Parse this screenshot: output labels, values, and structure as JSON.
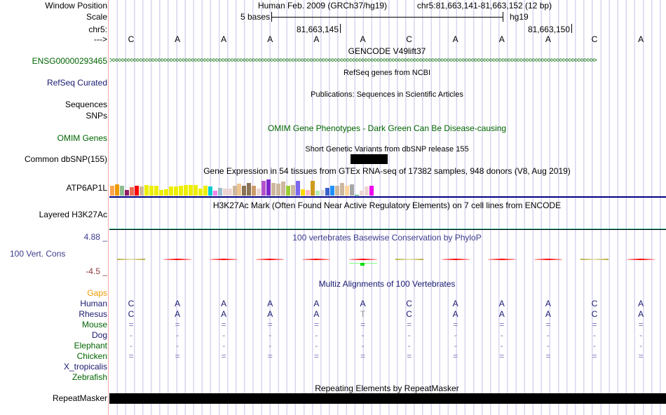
{
  "header": {
    "window_position_label": "Window Position",
    "assembly": "Human Feb. 2009 (GRCh37/hg19)",
    "position": "chr5:81,663,141-81,663,152 (12 bp)",
    "scale_label": "Scale",
    "scale_text": "5 bases",
    "scale_db": "hg19",
    "chrom_label": "chr5:",
    "tick1": "81,663,145",
    "tick2": "81,663,150",
    "strand_label": "--->"
  },
  "bases": [
    "C",
    "A",
    "A",
    "A",
    "A",
    "A",
    "C",
    "A",
    "A",
    "A",
    "C",
    "A"
  ],
  "tracks": {
    "gencode": {
      "title": "GENCODE V49lift37",
      "label": "ENSG00000293465",
      "color": "#006400"
    },
    "refseq": {
      "title": "RefSeq genes from NCBI",
      "label": "RefSeq Curated"
    },
    "pubs": {
      "title": "Publications: Sequences in Scientific Articles",
      "label1": "Sequences",
      "label2": "SNPs"
    },
    "omim": {
      "title": "OMIM Gene Phenotypes - Dark Green Can Be Disease-causing",
      "label": "OMIM Genes"
    },
    "dbsnp": {
      "title": "Short Genetic Variants from dbSNP release 155",
      "label": "Common dbSNP(155)"
    },
    "gtex": {
      "title": "Gene Expression in 54 tissues from GTEx RNA-seq of 17382 samples, 948 donors (V8, Aug 2019)",
      "label": "ATP6AP1L",
      "values": [
        14,
        12,
        14,
        20,
        16,
        14,
        15,
        13,
        14,
        14,
        20,
        19,
        15,
        15,
        14,
        13,
        13,
        13,
        18,
        14,
        15,
        21,
        17,
        18,
        18,
        14,
        11,
        14,
        10,
        14,
        18,
        7,
        5,
        10,
        11,
        8,
        14,
        13,
        7,
        19,
        20,
        7,
        21,
        20,
        17,
        14,
        14,
        10,
        14,
        12,
        27,
        21,
        15,
        14
      ],
      "colors": [
        "#ffa54f",
        "#ee9a00",
        "#8fbc8f",
        "#8b1c62",
        "#ee6a50",
        "#ff0000",
        "#cdb79e",
        "#eeee00",
        "#eeee00",
        "#eeee00",
        "#eeee00",
        "#eeee00",
        "#eeee00",
        "#eeee00",
        "#eeee00",
        "#eeee00",
        "#eeee00",
        "#eeee00",
        "#eeee00",
        "#eeee00",
        "#00cdcd",
        "#ee82ee",
        "#9ac0cd",
        "#eed5d2",
        "#eed5d2",
        "#cdb79e",
        "#eec591",
        "#8b7355",
        "#8b7355",
        "#cd9b69",
        "#eed5d2",
        "#b452cd",
        "#7d26cd",
        "#cdb79e",
        "#cdb79e",
        "#cdb79e",
        "#9acd32",
        "#cdb79e",
        "#7b68ee",
        "#ffd700",
        "#ffb6c1",
        "#cd9b1d",
        "#b4eeb4",
        "#d9d9d9",
        "#3a5fcd",
        "#1e90ff",
        "#cdb79e",
        "#cdb79e",
        "#ffd39b",
        "#a6a6a6",
        "#008b45",
        "#eed5d2",
        "#eed5d2",
        "#ee00ee"
      ]
    },
    "h3k27ac": {
      "title": "H3K27Ac Mark (Often Found Near Active Regulatory Elements) on 7 cell lines from ENCODE",
      "label": "Layered H3K27Ac"
    },
    "phylop": {
      "title": "100 vertebrates Basewise Conservation by PhyloP",
      "label": "100 Vert. Cons",
      "max": "4.88 _",
      "min": "-4.5 _",
      "scores": [
        "olive",
        "red",
        "red",
        "red",
        "red",
        "red+green",
        "olive",
        "red",
        "red",
        "red",
        "olive",
        "red"
      ]
    },
    "multiz": {
      "title": "Multiz Alignments of 100 Vertebrates",
      "gaps_label": "Gaps",
      "species": [
        {
          "name": "Human",
          "color": "#191970",
          "row": [
            "C",
            "A",
            "A",
            "A",
            "A",
            "A",
            "C",
            "A",
            "A",
            "A",
            "C",
            "A"
          ]
        },
        {
          "name": "Rhesus",
          "color": "#191970",
          "row": [
            "C",
            "A",
            "A",
            "A",
            "A",
            "T",
            "C",
            "A",
            "A",
            "A",
            "C",
            "A"
          ]
        },
        {
          "name": "Mouse",
          "color": "#006400",
          "row": [
            "=",
            "=",
            "=",
            "=",
            "=",
            "=",
            "=",
            "=",
            "=",
            "=",
            "=",
            "="
          ]
        },
        {
          "name": "Dog",
          "color": "#191970",
          "row": [
            "-",
            "-",
            "-",
            "-",
            "-",
            "-",
            "-",
            "-",
            "-",
            "-",
            "-",
            "-"
          ]
        },
        {
          "name": "Elephant",
          "color": "#006400",
          "row": [
            "-",
            "-",
            "-",
            "-",
            "-",
            "-",
            "-",
            "-",
            "-",
            "-",
            "-",
            "-"
          ]
        },
        {
          "name": "Chicken",
          "color": "#006400",
          "row": [
            "=",
            "=",
            "=",
            "=",
            "=",
            "=",
            "=",
            "=",
            "=",
            "=",
            "=",
            "="
          ]
        },
        {
          "name": "X_tropicalis",
          "color": "#191970",
          "row": []
        },
        {
          "name": "Zebrafish",
          "color": "#006400",
          "row": []
        }
      ]
    },
    "rmsk": {
      "title": "Repeating Elements by RepeatMasker",
      "label": "RepeatMasker"
    }
  }
}
